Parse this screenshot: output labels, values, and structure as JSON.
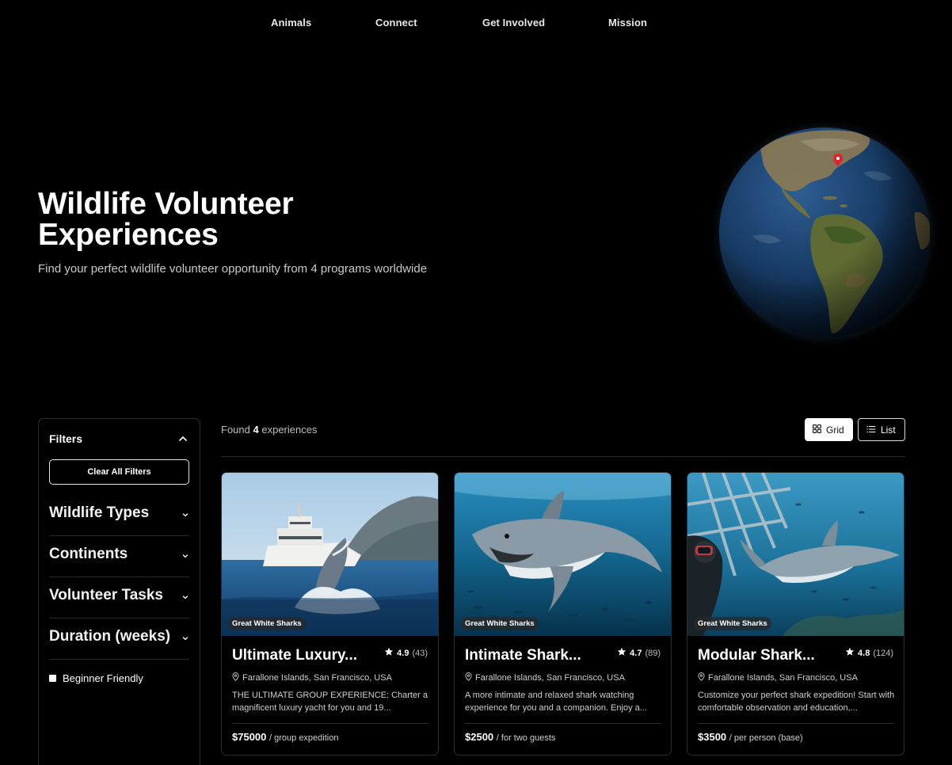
{
  "nav": {
    "items": [
      "Animals",
      "Connect",
      "Get Involved",
      "Mission"
    ]
  },
  "hero": {
    "title_line1": "Wildlife Volunteer",
    "title_line2": "Experiences",
    "subtitle": "Find your perfect wildlife volunteer opportunity from 4 programs worldwide"
  },
  "filters": {
    "heading": "Filters",
    "clear_label": "Clear All Filters",
    "sections": [
      "Wildlife Types",
      "Continents",
      "Volunteer Tasks",
      "Duration (weeks)"
    ],
    "beginner_label": "Beginner Friendly",
    "beginner_checked": false
  },
  "results": {
    "found_prefix": "Found",
    "found_count": "4",
    "found_suffix": "experiences",
    "view_grid": "Grid",
    "view_list": "List",
    "active_view": "Grid"
  },
  "cards": [
    {
      "badge": "Great White Sharks",
      "title": "Ultimate Luxury...",
      "rating": "4.9",
      "reviews": "(43)",
      "location": "Farallone Islands, San Francisco, USA",
      "description": "THE ULTIMATE GROUP EXPERIENCE: Charter a magnificent luxury yacht for you and 19...",
      "price": "$75000",
      "price_unit": "/ group expedition"
    },
    {
      "badge": "Great White Sharks",
      "title": "Intimate Shark...",
      "rating": "4.7",
      "reviews": "(89)",
      "location": "Farallone Islands, San Francisco, USA",
      "description": "A more intimate and relaxed shark watching experience for you and a companion. Enjoy a...",
      "price": "$2500",
      "price_unit": "/ for two guests"
    },
    {
      "badge": "Great White Sharks",
      "title": "Modular Shark...",
      "rating": "4.8",
      "reviews": "(124)",
      "location": "Farallone Islands, San Francisco, USA",
      "description": "Customize your perfect shark expedition! Start with comfortable observation and education,...",
      "price": "$3500",
      "price_unit": "/ per person (base)"
    }
  ],
  "colors": {
    "background": "#000000",
    "panel_border": "#2e2e2e",
    "ocean": "#1c4a7a",
    "marker": "#e0242f"
  }
}
